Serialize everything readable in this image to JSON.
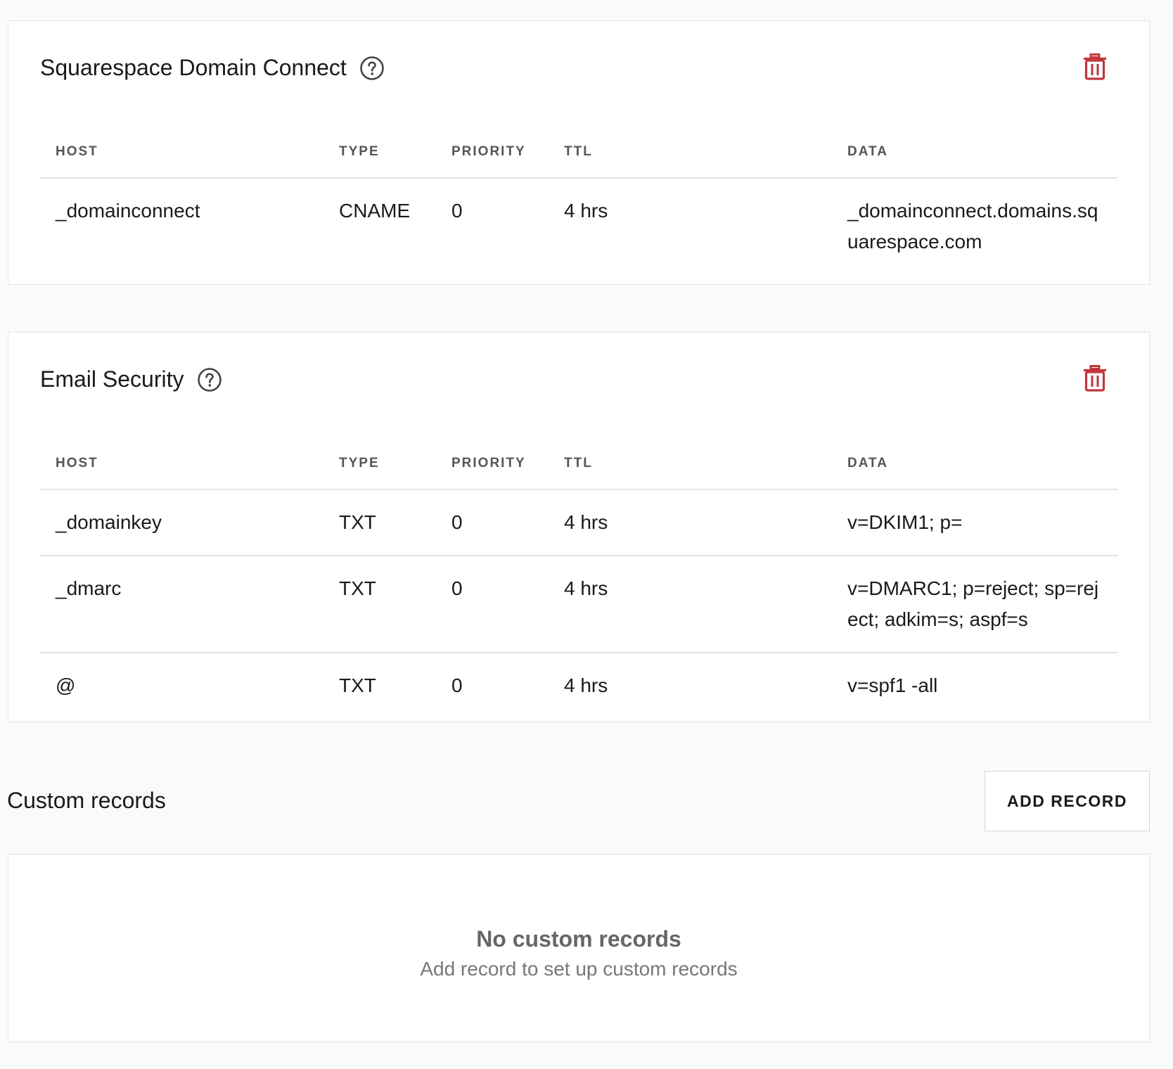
{
  "sections": [
    {
      "title": "Squarespace Domain Connect",
      "columns": [
        "HOST",
        "TYPE",
        "PRIORITY",
        "TTL",
        "DATA"
      ],
      "rows": [
        {
          "host": "_domainconnect",
          "type": "CNAME",
          "priority": "0",
          "ttl": "4 hrs",
          "data": "_domainconnect.domains.squarespace.com"
        }
      ]
    },
    {
      "title": "Email Security",
      "columns": [
        "HOST",
        "TYPE",
        "PRIORITY",
        "TTL",
        "DATA"
      ],
      "rows": [
        {
          "host": "_domainkey",
          "type": "TXT",
          "priority": "0",
          "ttl": "4 hrs",
          "data": "v=DKIM1; p="
        },
        {
          "host": "_dmarc",
          "type": "TXT",
          "priority": "0",
          "ttl": "4 hrs",
          "data": "v=DMARC1; p=reject; sp=reject; adkim=s; aspf=s"
        },
        {
          "host": "@",
          "type": "TXT",
          "priority": "0",
          "ttl": "4 hrs",
          "data": "v=spf1 -all"
        }
      ]
    }
  ],
  "custom_records": {
    "title": "Custom records",
    "add_button_label": "ADD RECORD",
    "empty_title": "No custom records",
    "empty_subtitle": "Add record to set up custom records"
  },
  "icons": {
    "help": "help-circle-icon",
    "delete": "trash-icon"
  },
  "colors": {
    "delete_icon": "#c0363c",
    "help_icon": "#444444",
    "border": "#e3e3e3"
  }
}
